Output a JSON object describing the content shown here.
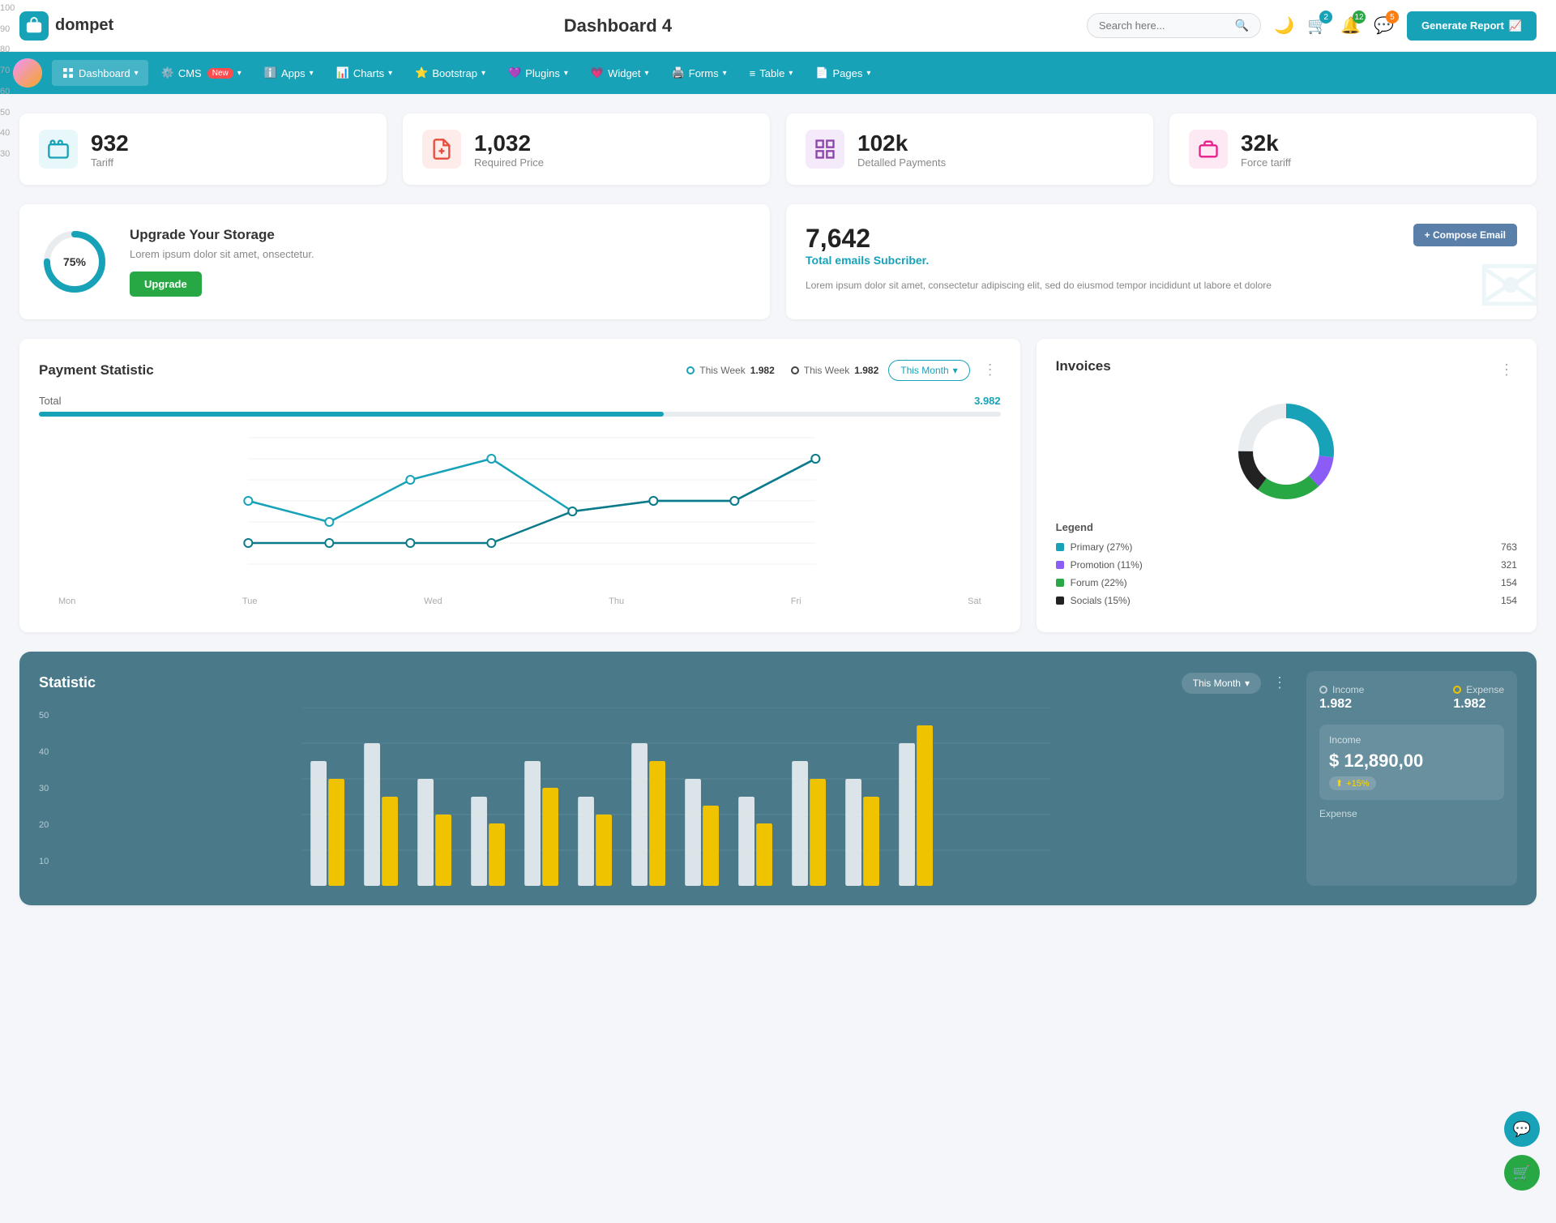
{
  "header": {
    "logo_icon": "💼",
    "logo_text": "dompet",
    "page_title": "Dashboard 4",
    "search_placeholder": "Search here...",
    "cart_badge": "2",
    "notif_badge": "12",
    "msg_badge": "5",
    "generate_btn": "Generate Report"
  },
  "navbar": {
    "items": [
      {
        "id": "dashboard",
        "label": "Dashboard",
        "active": true,
        "has_arrow": true
      },
      {
        "id": "cms",
        "label": "CMS",
        "badge": "New",
        "has_arrow": true
      },
      {
        "id": "apps",
        "label": "Apps",
        "has_arrow": true
      },
      {
        "id": "charts",
        "label": "Charts",
        "has_arrow": true
      },
      {
        "id": "bootstrap",
        "label": "Bootstrap",
        "has_arrow": true
      },
      {
        "id": "plugins",
        "label": "Plugins",
        "has_arrow": true
      },
      {
        "id": "widget",
        "label": "Widget",
        "has_arrow": true
      },
      {
        "id": "forms",
        "label": "Forms",
        "has_arrow": true
      },
      {
        "id": "table",
        "label": "Table",
        "has_arrow": true
      },
      {
        "id": "pages",
        "label": "Pages",
        "has_arrow": true
      }
    ]
  },
  "stat_cards": [
    {
      "id": "tariff",
      "value": "932",
      "label": "Tariff",
      "icon": "🏢",
      "color": "teal"
    },
    {
      "id": "required_price",
      "value": "1,032",
      "label": "Required Price",
      "icon": "📋",
      "color": "red"
    },
    {
      "id": "detailed_payments",
      "value": "102k",
      "label": "Detalled Payments",
      "icon": "📊",
      "color": "purple"
    },
    {
      "id": "force_tariff",
      "value": "32k",
      "label": "Force tariff",
      "icon": "🏭",
      "color": "pink"
    }
  ],
  "storage": {
    "progress": 75,
    "progress_label": "75%",
    "title": "Upgrade Your Storage",
    "description": "Lorem ipsum dolor sit amet, onsectetur.",
    "btn_label": "Upgrade",
    "circle_color": "#17a2b8",
    "circle_bg": "#e8ecef"
  },
  "email": {
    "count": "7,642",
    "subtitle": "Total emails Subcriber.",
    "description": "Lorem ipsum dolor sit amet, consectetur adipiscing elit, sed do eiusmod tempor incididunt ut labore et dolore",
    "compose_btn": "+ Compose Email"
  },
  "payment": {
    "title": "Payment Statistic",
    "filter_label": "This Month",
    "legend_1_label": "This Week",
    "legend_1_value": "1.982",
    "legend_2_label": "This Week",
    "legend_2_value": "1.982",
    "total_label": "Total",
    "total_value": "3.982",
    "progress_pct": 65,
    "x_labels": [
      "Mon",
      "Tue",
      "Wed",
      "Thu",
      "Fri",
      "Sat"
    ],
    "y_labels": [
      "100",
      "90",
      "80",
      "70",
      "60",
      "50",
      "40",
      "30"
    ],
    "line1": [
      62,
      50,
      70,
      80,
      65,
      62,
      65,
      88
    ],
    "line2": [
      40,
      40,
      40,
      40,
      62,
      65,
      60,
      88
    ]
  },
  "invoices": {
    "title": "Invoices",
    "legend": [
      {
        "label": "Primary (27%)",
        "color": "#17a2b8",
        "value": "763"
      },
      {
        "label": "Promotion (11%)",
        "color": "#8b5cf6",
        "value": "321"
      },
      {
        "label": "Forum (22%)",
        "color": "#28a745",
        "value": "154"
      },
      {
        "label": "Socials (15%)",
        "color": "#222",
        "value": "154"
      }
    ],
    "donut_segments": [
      {
        "label": "Primary",
        "pct": 27,
        "color": "#17a2b8"
      },
      {
        "label": "Promotion",
        "pct": 11,
        "color": "#8b5cf6"
      },
      {
        "label": "Forum",
        "pct": 22,
        "color": "#28a745"
      },
      {
        "label": "Socials",
        "pct": 15,
        "color": "#222"
      },
      {
        "label": "Other",
        "pct": 25,
        "color": "#e8ecef"
      }
    ]
  },
  "statistic": {
    "title": "Statistic",
    "filter_label": "This Month",
    "y_labels": [
      "50",
      "40",
      "30",
      "20",
      "10"
    ],
    "income_label": "Income",
    "income_value": "1.982",
    "expense_label": "Expense",
    "expense_value": "1.982",
    "income_box_label": "Income",
    "income_amount": "$ 12,890,00",
    "income_pct": "+15%",
    "expense_section_label": "Expense"
  },
  "fab": {
    "chat_icon": "💬",
    "cart_icon": "🛒"
  }
}
